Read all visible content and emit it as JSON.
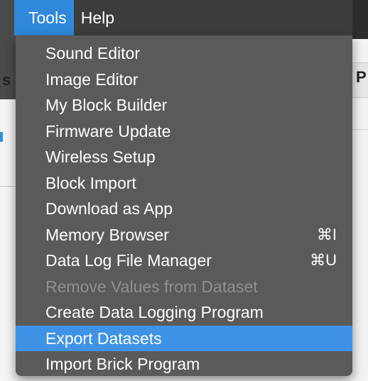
{
  "menubar": {
    "items": [
      {
        "label": "Tools",
        "active": true
      },
      {
        "label": "Help",
        "active": false
      }
    ]
  },
  "tools_menu": {
    "items": [
      {
        "label": "Sound Editor",
        "shortcut": "",
        "enabled": true,
        "highlighted": false
      },
      {
        "label": "Image Editor",
        "shortcut": "",
        "enabled": true,
        "highlighted": false
      },
      {
        "label": "My Block Builder",
        "shortcut": "",
        "enabled": true,
        "highlighted": false
      },
      {
        "label": "Firmware Update",
        "shortcut": "",
        "enabled": true,
        "highlighted": false
      },
      {
        "label": "Wireless Setup",
        "shortcut": "",
        "enabled": true,
        "highlighted": false
      },
      {
        "label": "Block Import",
        "shortcut": "",
        "enabled": true,
        "highlighted": false
      },
      {
        "label": "Download as App",
        "shortcut": "",
        "enabled": true,
        "highlighted": false
      },
      {
        "label": "Memory Browser",
        "shortcut": "⌘I",
        "enabled": true,
        "highlighted": false
      },
      {
        "label": "Data Log File Manager",
        "shortcut": "⌘U",
        "enabled": true,
        "highlighted": false
      },
      {
        "label": "Remove Values from Dataset",
        "shortcut": "",
        "enabled": false,
        "highlighted": false
      },
      {
        "label": "Create Data Logging Program",
        "shortcut": "",
        "enabled": true,
        "highlighted": false
      },
      {
        "label": "Export Datasets",
        "shortcut": "",
        "enabled": true,
        "highlighted": true
      },
      {
        "label": "Import Brick Program",
        "shortcut": "",
        "enabled": true,
        "highlighted": false
      }
    ]
  },
  "background": {
    "left_glyph": "s",
    "right_glyph": "P"
  },
  "colors": {
    "menubar_bg": "#3d3d3d",
    "menu_bg": "#5a5a5a",
    "highlight": "#3f93e6",
    "active_menu": "#2f88d9",
    "disabled_text": "#8f8f8f"
  }
}
